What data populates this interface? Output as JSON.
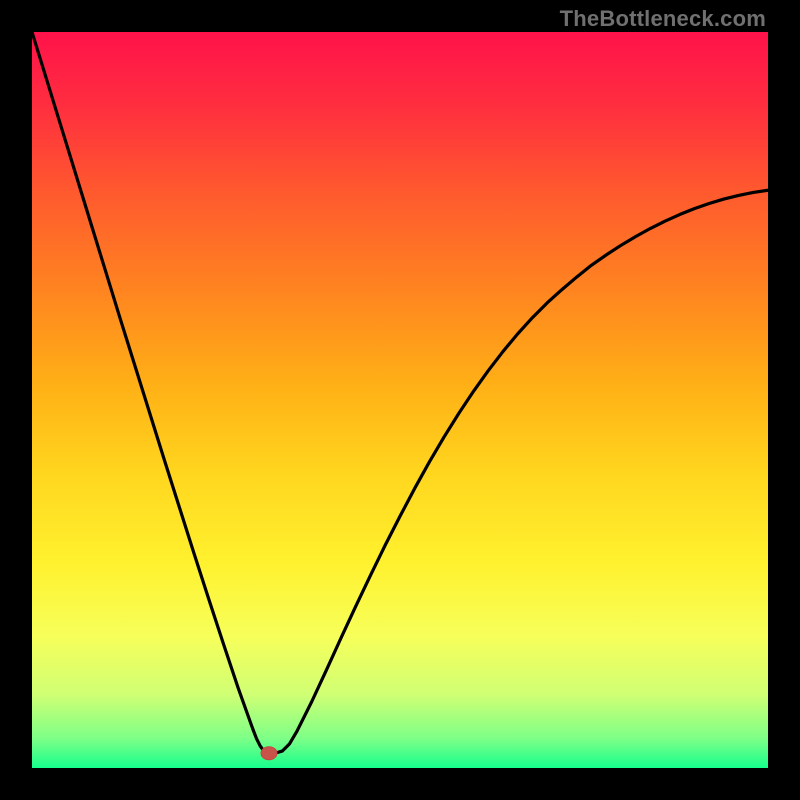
{
  "watermark": "TheBottleneck.com",
  "colors": {
    "black_border": "#000000",
    "curve": "#000000",
    "marker_fill": "#c9534b",
    "marker_stroke": "#c4493f",
    "gradient_stops": [
      {
        "offset": 0.0,
        "color": "#ff124a"
      },
      {
        "offset": 0.1,
        "color": "#ff2e3f"
      },
      {
        "offset": 0.22,
        "color": "#ff5a2e"
      },
      {
        "offset": 0.35,
        "color": "#ff8420"
      },
      {
        "offset": 0.48,
        "color": "#ffb016"
      },
      {
        "offset": 0.6,
        "color": "#ffd61e"
      },
      {
        "offset": 0.72,
        "color": "#fff12e"
      },
      {
        "offset": 0.82,
        "color": "#f7ff5a"
      },
      {
        "offset": 0.9,
        "color": "#d0ff74"
      },
      {
        "offset": 0.96,
        "color": "#7dff87"
      },
      {
        "offset": 1.0,
        "color": "#17ff8d"
      }
    ]
  },
  "chart_data": {
    "type": "line",
    "title": "",
    "xlabel": "",
    "ylabel": "",
    "xlim": [
      0,
      100
    ],
    "ylim": [
      0,
      100
    ],
    "x": [
      0,
      2,
      4,
      6,
      8,
      10,
      12,
      14,
      16,
      18,
      20,
      22,
      24,
      26,
      28,
      30,
      30.5,
      31,
      31.5,
      32,
      33,
      34,
      35,
      36,
      38,
      40,
      42,
      44,
      46,
      48,
      50,
      52,
      54,
      56,
      58,
      60,
      62,
      64,
      66,
      68,
      70,
      72,
      74,
      76,
      78,
      80,
      82,
      84,
      86,
      88,
      90,
      92,
      94,
      96,
      98,
      100
    ],
    "values": [
      100,
      93.5,
      87,
      80.5,
      74,
      67.5,
      61,
      54.6,
      48.2,
      41.8,
      35.5,
      29.2,
      23,
      16.9,
      10.9,
      5.3,
      4.0,
      3.0,
      2.3,
      2.0,
      2.0,
      2.3,
      3.3,
      5.0,
      9.0,
      13.3,
      17.7,
      22.0,
      26.2,
      30.3,
      34.2,
      38.0,
      41.6,
      45.0,
      48.2,
      51.2,
      54.0,
      56.6,
      59.0,
      61.2,
      63.2,
      65.0,
      66.7,
      68.3,
      69.7,
      71.0,
      72.2,
      73.3,
      74.3,
      75.2,
      76.0,
      76.7,
      77.3,
      77.8,
      78.2,
      78.5
    ],
    "optimum_marker": {
      "x": 32.2,
      "y": 2.0
    }
  }
}
